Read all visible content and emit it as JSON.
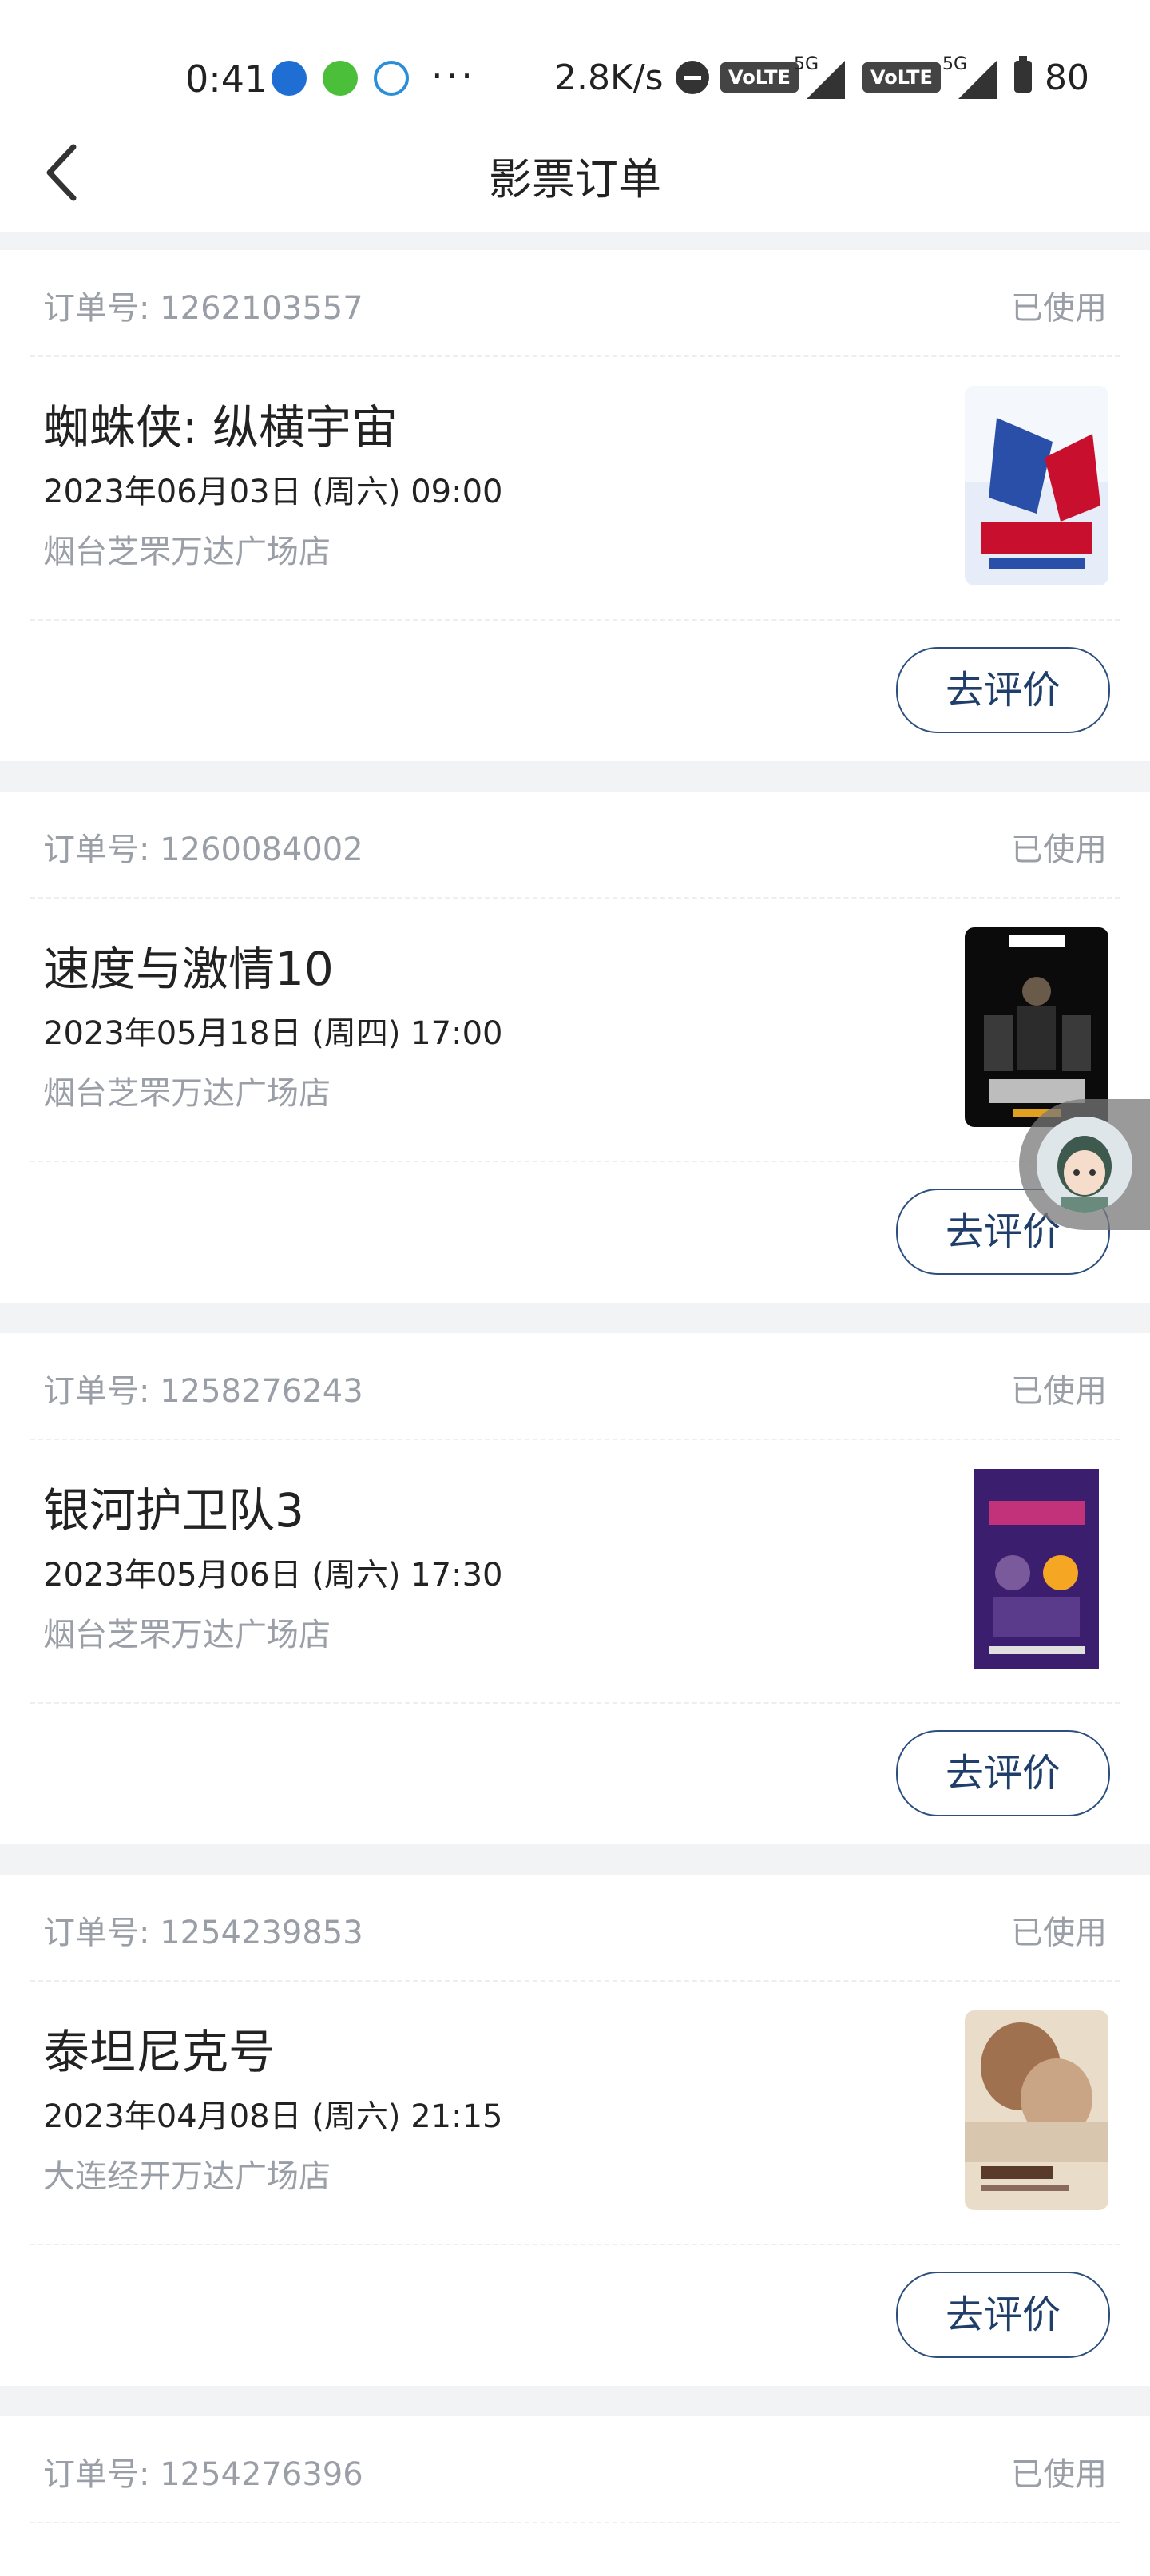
{
  "status_bar": {
    "time": "0:41",
    "more": "···",
    "net_speed": "2.8K/s",
    "volte_1": "VoLTE",
    "volte_2": "VoLTE",
    "signal_1": "5G",
    "signal_2": "5G",
    "battery": "80",
    "icons": [
      "shield-app-icon",
      "wechat-icon",
      "browser-icon",
      "do-not-disturb-icon",
      "signal-icon",
      "battery-icon"
    ]
  },
  "header": {
    "title": "影票订单",
    "back_icon": "chevron-left-icon"
  },
  "orders": [
    {
      "order_label": "订单号: 1262103557",
      "status": "已使用",
      "movie": "蜘蛛侠: 纵横宇宙",
      "showtime": "2023年06月03日 (周六) 09:00",
      "cinema": "烟台芝罘万达广场店",
      "button": "去评价",
      "poster_colors": [
        "#dfe8f5",
        "#2a4fa8",
        "#c8102e"
      ]
    },
    {
      "order_label": "订单号: 1260084002",
      "status": "已使用",
      "movie": "速度与激情10",
      "showtime": "2023年05月18日 (周四) 17:00",
      "cinema": "烟台芝罘万达广场店",
      "button": "去评价",
      "poster_colors": [
        "#0b0b0b",
        "#3a3a3a",
        "#d9d9d9"
      ]
    },
    {
      "order_label": "订单号: 1258276243",
      "status": "已使用",
      "movie": "银河护卫队3",
      "showtime": "2023年05月06日 (周六) 17:30",
      "cinema": "烟台芝罘万达广场店",
      "button": "去评价",
      "poster_colors": [
        "#3b1e6e",
        "#c2327a",
        "#f5a623"
      ]
    },
    {
      "order_label": "订单号: 1254239853",
      "status": "已使用",
      "movie": "泰坦尼克号",
      "showtime": "2023年04月08日 (周六) 21:15",
      "cinema": "大连经开万达广场店",
      "button": "去评价",
      "poster_colors": [
        "#e9dcc9",
        "#a0714f",
        "#5a3a2a"
      ]
    },
    {
      "order_label": "订单号: 1254276396",
      "status": "已使用"
    }
  ],
  "floating_assistant": {
    "icon": "assistant-avatar-icon"
  }
}
